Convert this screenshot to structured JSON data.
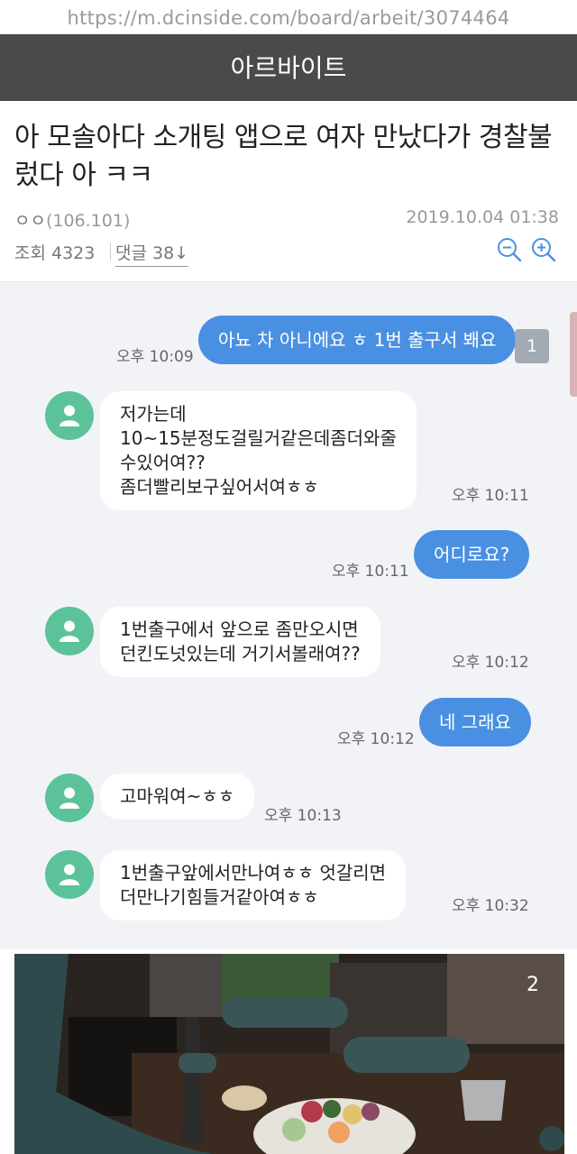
{
  "browser": {
    "url": "https://m.dcinside.com/board/arbeit/3074464"
  },
  "board": {
    "title": "아르바이트"
  },
  "post": {
    "title": "아 모솔아다 소개팅 앱으로 여자 만났다가 경찰불렀다 아 ㅋㅋ",
    "author": "ㅇㅇ",
    "author_ip": "(106.101)",
    "date": "2019.10.04 01:38",
    "views": "조회 4323",
    "comments": "댓글 38",
    "comments_arrow": "↓"
  },
  "chat": {
    "badge": "1",
    "messages": [
      {
        "side": "out",
        "text": "아뇨 차 아니에요 ㅎ 1번 출구서 봬요",
        "time": "오후 10:09"
      },
      {
        "side": "in",
        "lines": [
          "저가는데",
          "10~15분정도걸릴거같은데좀더와줄",
          "수있어여??",
          "좀더빨리보구싶어서여ㅎㅎ"
        ],
        "time": "오후 10:11"
      },
      {
        "side": "out",
        "text": "어디로요?",
        "time": "오후 10:11"
      },
      {
        "side": "in",
        "lines": [
          "1번출구에서 앞으로 좀만오시면",
          "던킨도넛있는데 거기서볼래여??"
        ],
        "time": "오후 10:12"
      },
      {
        "side": "out",
        "text": "네 그래요",
        "time": "오후 10:12"
      },
      {
        "side": "in",
        "lines": [
          "고마워여~ㅎㅎ"
        ],
        "time": "오후 10:13"
      },
      {
        "side": "in",
        "lines": [
          "1번출구앞에서만나여ㅎㅎ 엇갈리면",
          "더만나기힘들거같아여ㅎㅎ"
        ],
        "time": "오후 10:32"
      }
    ]
  },
  "photo": {
    "index": "2"
  },
  "colors": {
    "header_bg": "#4a4a4a",
    "bubble_out": "#4a90e2",
    "avatar": "#5cc29a",
    "chat_bg": "#f2f3f7"
  },
  "icons": [
    "zoom-out-icon",
    "zoom-in-icon",
    "person-icon"
  ]
}
